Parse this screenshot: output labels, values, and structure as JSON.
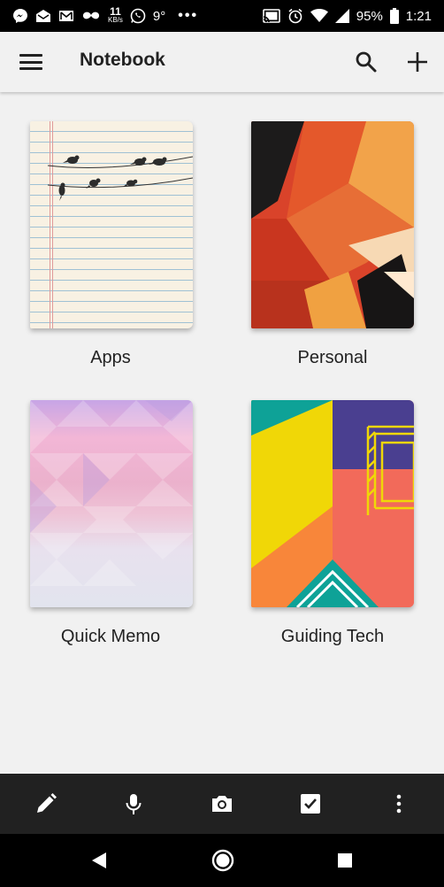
{
  "status_bar": {
    "net_speed": "11",
    "net_unit": "KB/s",
    "temperature": "9°",
    "overflow_dots": "•••",
    "battery": "95%",
    "time": "1:21"
  },
  "app_bar": {
    "title": "Notebook",
    "icons": [
      "menu-icon",
      "search-icon",
      "add-icon"
    ]
  },
  "notebooks": [
    {
      "name": "Apps",
      "cover": "lined-paper-birds"
    },
    {
      "name": "Personal",
      "cover": "abstract-orange-red"
    },
    {
      "name": "Quick Memo",
      "cover": "pink-triangles"
    },
    {
      "name": "Guiding Tech",
      "cover": "geometric-colors"
    }
  ],
  "toolbar": {
    "icons": [
      "pencil-icon",
      "microphone-icon",
      "camera-icon",
      "checkbox-icon",
      "more-vert-icon"
    ]
  },
  "nav_bar": {
    "icons": [
      "back-icon",
      "home-icon",
      "recents-icon"
    ]
  },
  "colors": {
    "toolbar_bg": "#212121",
    "background": "#f1f1f1",
    "accent_orange": "#e0562a"
  }
}
